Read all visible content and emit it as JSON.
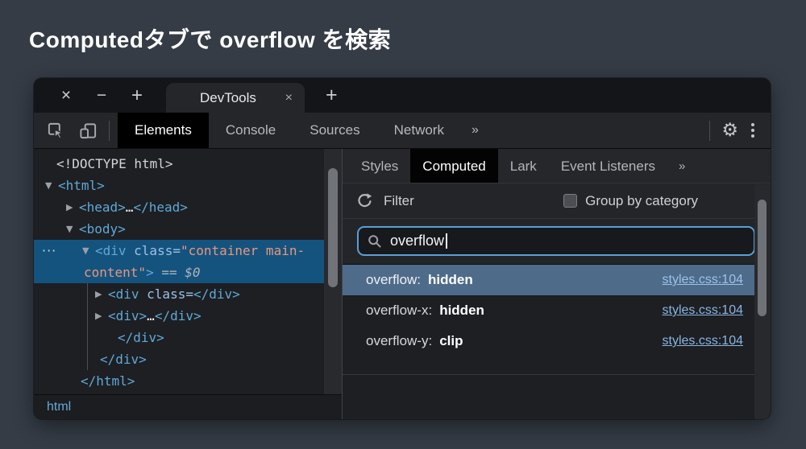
{
  "page_title": "Computedタブで overflow を検索",
  "colors": {
    "page_background": "#353c46",
    "selection_blue": "#15537f",
    "result_highlight": "#4e6b8a",
    "link_blue": "#8ab5e2",
    "tag_blue": "#5fa8d8",
    "attr_value_salmon": "#e8977b",
    "search_focus_border": "#5b9fd6",
    "active_tab_bg": "#000000"
  },
  "window_bar": {
    "close": "×",
    "minimize": "−",
    "maximize": "+",
    "tab_title": "DevTools",
    "tab_close": "×",
    "new_tab": "+"
  },
  "toolbar": {
    "panel_tabs": [
      "Elements",
      "Console",
      "Sources",
      "Network"
    ],
    "more": "»"
  },
  "icons": {
    "gear": "⚙"
  },
  "elements_tree": {
    "arrows": {
      "open": "▼",
      "closed": "▶"
    },
    "more_dots": "···",
    "doctype": "<!DOCTYPE html>",
    "html_open": "<html>",
    "head_open": "<head>",
    "head_ellipsis": "…",
    "head_close": "</head>",
    "body_open": "<body>",
    "selected": {
      "tag_open": "<div",
      "attr_name": " class=",
      "value_line1": "\"container main-",
      "value_line2": "content\"",
      "bracket": ">",
      "dollar_flag": " == $0"
    },
    "child1": {
      "tag_open": "<div",
      "attr_name": " class=",
      "close": "</div>"
    },
    "child2": {
      "open": "<div>",
      "ellipsis": "…",
      "close": "</div>"
    },
    "close_inner": "</div>",
    "close_outer": "</div>",
    "html_close": "</html>",
    "breadcrumb": "html"
  },
  "sidebar": {
    "tabs": [
      "Styles",
      "Computed",
      "Lark",
      "Event Listeners"
    ],
    "more": "»",
    "filter_label": "Filter",
    "group_by_label": "Group by category",
    "search_value": "overflow",
    "results": [
      {
        "property": "overflow:",
        "value": "hidden",
        "link": "styles.css:104"
      },
      {
        "property": "overflow-x:",
        "value": "hidden",
        "link": "styles.css:104"
      },
      {
        "property": "overflow-y:",
        "value": "clip",
        "link": "styles.css:104"
      }
    ]
  }
}
